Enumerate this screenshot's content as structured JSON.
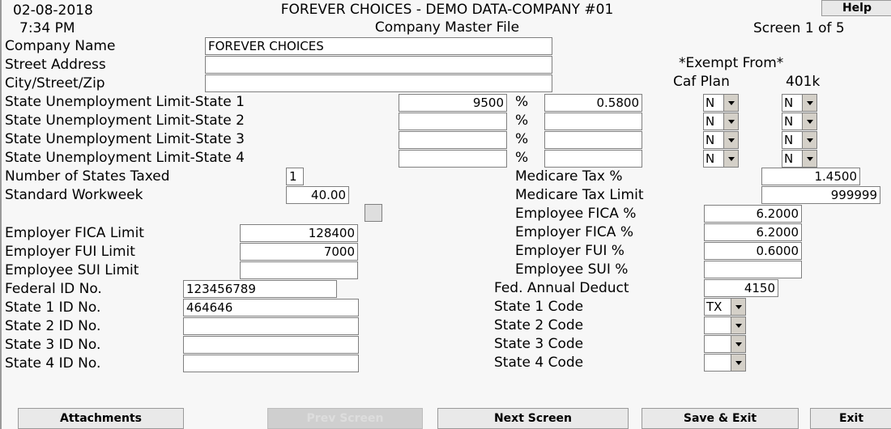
{
  "header": {
    "date": "02-08-2018",
    "time": "7:34 PM",
    "title": "FOREVER CHOICES - DEMO DATA-COMPANY #01",
    "subtitle": "Company Master File",
    "screen_indicator": "Screen 1 of 5",
    "help_label": "Help"
  },
  "exempt": {
    "heading": "*Exempt From*",
    "col1": "Caf Plan",
    "col2": "401k",
    "caf_values": [
      "N",
      "N",
      "N",
      "N"
    ],
    "k401_values": [
      "N",
      "N",
      "N",
      "N"
    ]
  },
  "company": {
    "name_label": "Company Name",
    "name_value": "FOREVER CHOICES",
    "street_label": "Street Address",
    "street_value": "",
    "city_label": "City/Street/Zip",
    "city_value": ""
  },
  "sui": {
    "rows": [
      {
        "label": "State Unemployment Limit-State 1",
        "limit": "9500",
        "pct_symbol": "%",
        "pct": "0.5800"
      },
      {
        "label": "State Unemployment Limit-State 2",
        "limit": "",
        "pct_symbol": "%",
        "pct": ""
      },
      {
        "label": "State Unemployment Limit-State 3",
        "limit": "",
        "pct_symbol": "%",
        "pct": ""
      },
      {
        "label": "State Unemployment Limit-State 4",
        "limit": "",
        "pct_symbol": "%",
        "pct": ""
      }
    ]
  },
  "left": {
    "states_taxed_label": "Number of States Taxed",
    "states_taxed_value": "1",
    "workweek_label": "Standard Workweek",
    "workweek_value": "40.00",
    "employer_fica_limit_label": "Employer FICA Limit",
    "employer_fica_limit_value": "128400",
    "employer_fui_limit_label": "Employer FUI Limit",
    "employer_fui_limit_value": "7000",
    "employee_sui_limit_label": "Employee SUI Limit",
    "employee_sui_limit_value": "",
    "federal_id_label": "Federal ID No.",
    "federal_id_value": "123456789",
    "state_ids": [
      {
        "label": "State 1 ID No.",
        "value": "464646"
      },
      {
        "label": "State 2 ID No.",
        "value": ""
      },
      {
        "label": "State 3 ID No.",
        "value": ""
      },
      {
        "label": "State 4 ID No.",
        "value": ""
      }
    ]
  },
  "right": {
    "medicare_tax_pct_label": "Medicare Tax %",
    "medicare_tax_pct_value": "1.4500",
    "medicare_tax_limit_label": "Medicare Tax Limit",
    "medicare_tax_limit_value": "999999",
    "employee_fica_pct_label": "Employee FICA %",
    "employee_fica_pct_value": "6.2000",
    "employer_fica_pct_label": "Employer FICA %",
    "employer_fica_pct_value": "6.2000",
    "employer_fui_pct_label": "Employer FUI %",
    "employer_fui_pct_value": "0.6000",
    "employee_sui_pct_label": "Employee SUI %",
    "employee_sui_pct_value": "",
    "fed_annual_deduct_label": "Fed. Annual Deduct",
    "fed_annual_deduct_value": "4150",
    "state_codes": [
      {
        "label": "State 1 Code",
        "value": "TX"
      },
      {
        "label": "State 2 Code",
        "value": ""
      },
      {
        "label": "State 3 Code",
        "value": ""
      },
      {
        "label": "State 4 Code",
        "value": ""
      }
    ]
  },
  "footer": {
    "attachments": "Attachments",
    "prev_screen": "Prev Screen",
    "next_screen": "Next Screen",
    "save_exit": "Save & Exit",
    "exit": "Exit"
  }
}
